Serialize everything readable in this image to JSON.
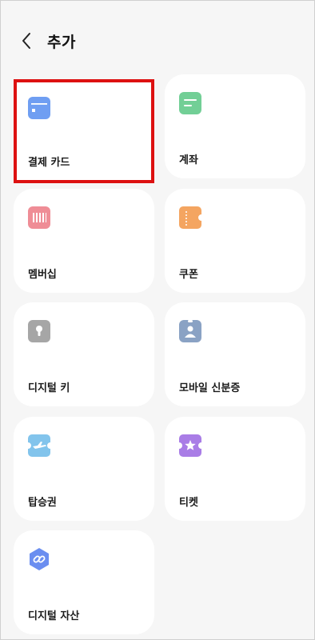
{
  "header": {
    "title": "추가"
  },
  "cards": [
    {
      "label": "결제 카드",
      "icon": "payment-card-icon",
      "color": "#6f9ef2"
    },
    {
      "label": "계좌",
      "icon": "bank-account-icon",
      "color": "#72cf96"
    },
    {
      "label": "멤버십",
      "icon": "membership-icon",
      "color": "#ef8d96"
    },
    {
      "label": "쿠폰",
      "icon": "coupon-icon",
      "color": "#f4a561"
    },
    {
      "label": "디지털 키",
      "icon": "digital-key-icon",
      "color": "#a6a6a6"
    },
    {
      "label": "모바일 신분증",
      "icon": "mobile-id-icon",
      "color": "#8aa2c4"
    },
    {
      "label": "탑승권",
      "icon": "boarding-pass-icon",
      "color": "#82c4ec"
    },
    {
      "label": "티켓",
      "icon": "ticket-icon",
      "color": "#a97de6"
    },
    {
      "label": "디지털 자산",
      "icon": "digital-asset-icon",
      "color": "#6b8ef0"
    }
  ],
  "highlight_color": "#dd1111"
}
